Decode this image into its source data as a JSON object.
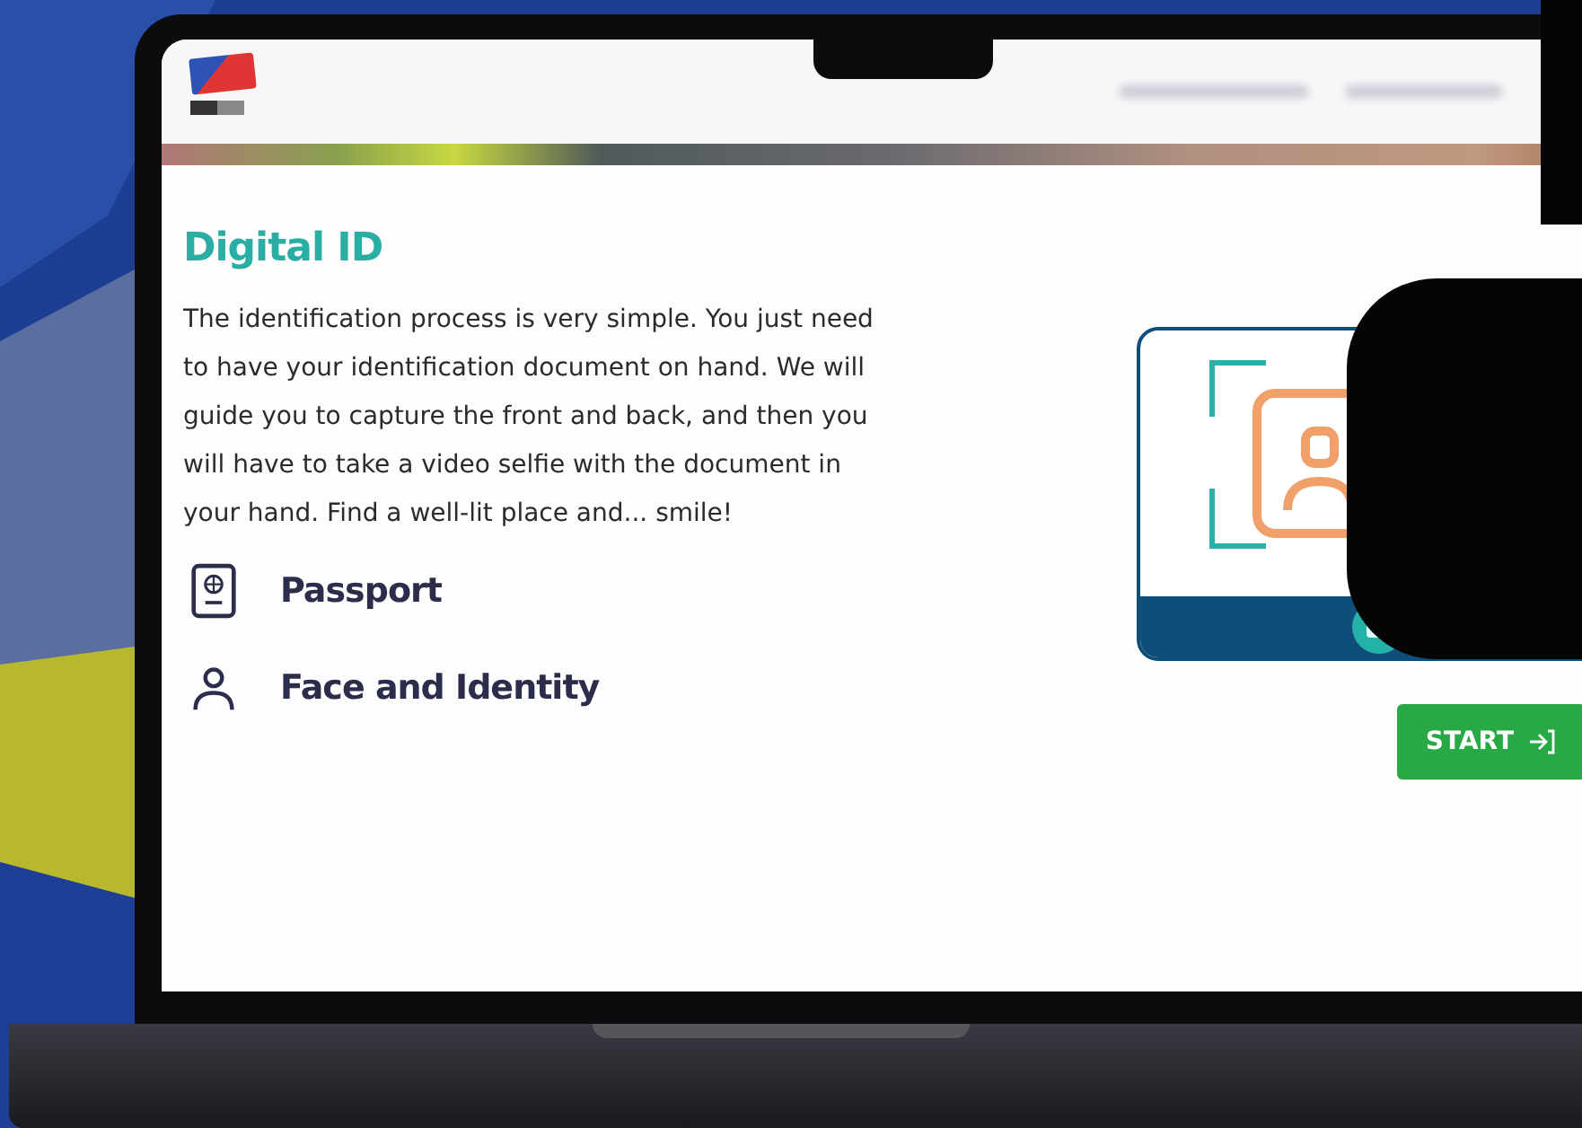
{
  "content": {
    "title": "Digital ID",
    "description": "The identification process is very simple. You just need to have your identification document on hand. We will guide you to capture the front and back, and then you will have to take a video selfie with the document in your hand. Find a well-lit place and... smile!",
    "items": [
      {
        "kind": "passport",
        "label": "Passport"
      },
      {
        "kind": "person",
        "label": "Face and Identity"
      }
    ],
    "start_button": {
      "label": "START"
    }
  }
}
